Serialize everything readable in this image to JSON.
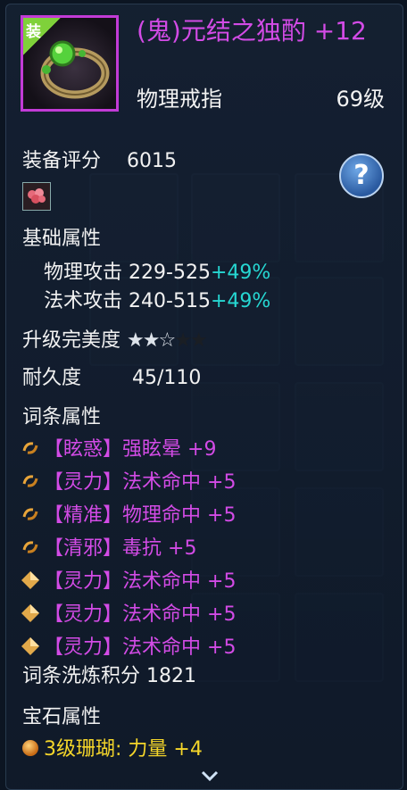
{
  "item": {
    "corner_tag": "装",
    "name": "(鬼)元结之独酌 +12",
    "type": "物理戒指",
    "level": "69级"
  },
  "score": {
    "label": "装备评分",
    "value": "6015"
  },
  "help_icon": "question-icon",
  "base": {
    "title": "基础属性",
    "attrs": [
      {
        "name": "物理攻击",
        "value": "229-525",
        "bonus": "+49%"
      },
      {
        "name": "法术攻击",
        "value": "240-515",
        "bonus": "+49%"
      }
    ]
  },
  "perfection": {
    "label": "升级完美度",
    "stars": "★★☆",
    "dark_stars": "★★",
    "filled": 2,
    "total": 5
  },
  "durability": {
    "label": "耐久度",
    "value": "45/110"
  },
  "affixes": {
    "title": "词条属性",
    "items": [
      {
        "icon": "swirl-icon",
        "tag": "【眩惑】",
        "text": "强眩晕 +9"
      },
      {
        "icon": "swirl-icon",
        "tag": "【灵力】",
        "text": "法术命中 +5"
      },
      {
        "icon": "swirl-icon",
        "tag": "【精准】",
        "text": "物理命中 +5"
      },
      {
        "icon": "swirl-icon",
        "tag": "【清邪】",
        "text": "毒抗 +5"
      },
      {
        "icon": "diamond-icon",
        "tag": "【灵力】",
        "text": "法术命中 +5"
      },
      {
        "icon": "diamond-icon",
        "tag": "【灵力】",
        "text": "法术命中 +5"
      },
      {
        "icon": "diamond-icon",
        "tag": "【灵力】",
        "text": "法术命中 +5"
      }
    ]
  },
  "refine": {
    "label": "词条洗炼积分",
    "value": "1821"
  },
  "gems": {
    "title": "宝石属性",
    "items": [
      {
        "name": "3级珊瑚: 力量 +4"
      }
    ]
  },
  "colors": {
    "name": "#d34be6",
    "bonus": "#26d7d2",
    "gem": "#f5d62a",
    "border": "#c23bd6"
  }
}
